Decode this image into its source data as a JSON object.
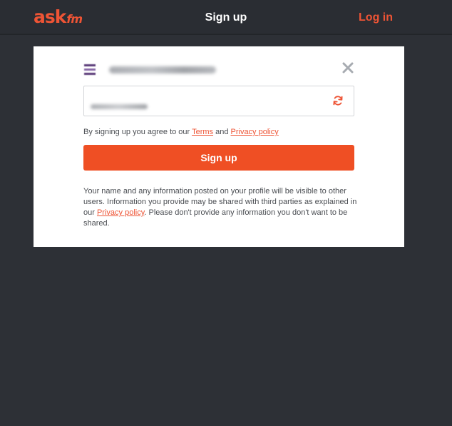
{
  "header": {
    "logo_ask": "ask",
    "logo_fm": "fm",
    "title": "Sign up",
    "login_label": "Log in"
  },
  "modal": {
    "terms_prefix": "By signing up you agree to our ",
    "terms_link": "Terms",
    "terms_and": " and ",
    "privacy_link": "Privacy policy",
    "signup_label": "Sign up",
    "info_before": "Your name and any information posted on your profile will be visible to other users. Information you provide may be shared with third parties as explained in our ",
    "info_link": "Privacy policy",
    "info_after": ". Please don't provide any information you don't want to be shared."
  },
  "colors": {
    "brand": "#ee5435",
    "button": "#ef4f24",
    "background": "#2d3036",
    "panel": "#ffffff"
  },
  "icons": {
    "close": "close-icon",
    "refresh": "refresh-icon",
    "account": "account-avatar-icon"
  }
}
